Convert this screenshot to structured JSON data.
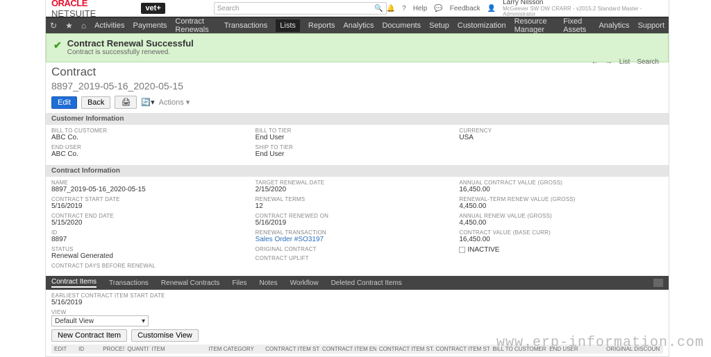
{
  "brand": {
    "oracle": "ORACLE",
    "suite": " NETSUITE",
    "vet": "vet+"
  },
  "search": {
    "placeholder": "Search"
  },
  "topright": {
    "help": "Help",
    "feedback": "Feedback"
  },
  "user": {
    "name": "Larry Nilsson",
    "role": "McGeever SW OW CRARR - v2015.2 Standard Master - Administrator"
  },
  "menu": {
    "items": [
      "Activities",
      "Payments",
      "Contract Renewals",
      "Transactions",
      "Lists",
      "Reports",
      "Analytics",
      "Documents",
      "Setup",
      "Customization",
      "Resource Manager",
      "Fixed Assets",
      "Analytics",
      "Support"
    ],
    "active_index": 4
  },
  "banner": {
    "title": "Contract Renewal Successful",
    "sub": "Contract is successfully renewed."
  },
  "record": {
    "type": "Contract",
    "name": "8897_2019-05-16_2020-05-15"
  },
  "buttons": {
    "edit": "Edit",
    "back": "Back",
    "actions": "Actions"
  },
  "pagenav": {
    "list": "List",
    "search": "Search"
  },
  "sections": {
    "customer": {
      "title": "Customer Information",
      "c1": [
        {
          "label": "BILL TO CUSTOMER",
          "value": "ABC Co."
        },
        {
          "label": "END USER",
          "value": "ABC Co."
        }
      ],
      "c2": [
        {
          "label": "BILL TO TIER",
          "value": "End User"
        },
        {
          "label": "SHIP TO TIER",
          "value": "End User"
        }
      ],
      "c3": [
        {
          "label": "CURRENCY",
          "value": "USA"
        }
      ]
    },
    "contract": {
      "title": "Contract Information",
      "c1": [
        {
          "label": "NAME",
          "value": "8897_2019-05-16_2020-05-15"
        },
        {
          "label": "CONTRACT START DATE",
          "value": "5/16/2019"
        },
        {
          "label": "CONTRACT END DATE",
          "value": "5/15/2020"
        },
        {
          "label": "ID",
          "value": "8897"
        },
        {
          "label": "STATUS",
          "value": "Renewal Generated"
        },
        {
          "label": "CONTRACT DAYS BEFORE RENEWAL",
          "value": ""
        }
      ],
      "c2": [
        {
          "label": "TARGET RENEWAL DATE",
          "value": "2/15/2020"
        },
        {
          "label": "RENEWAL TERMS",
          "value": "12"
        },
        {
          "label": "CONTRACT RENEWED ON",
          "value": "5/16/2019"
        },
        {
          "label": "RENEWAL TRANSACTION",
          "value": "Sales Order #SO3197",
          "link": true
        },
        {
          "label": "ORIGINAL CONTRACT",
          "value": ""
        },
        {
          "label": "CONTRACT UPLIFT",
          "value": ""
        }
      ],
      "c3": [
        {
          "label": "ANNUAL CONTRACT VALUE (GROSS)",
          "value": "16,450.00"
        },
        {
          "label": "RENEWAL-TERM RENEW VALUE (GROSS)",
          "value": "4,450.00"
        },
        {
          "label": "ANNUAL RENEW VALUE (GROSS)",
          "value": "4,450.00"
        },
        {
          "label": "CONTRACT VALUE (BASE CURR)",
          "value": "16,450.00"
        },
        {
          "label": "INACTIVE",
          "value": "",
          "checkbox": true
        }
      ]
    }
  },
  "subtabs": [
    "Contract Items",
    "Transactions",
    "Renewal Contracts",
    "Files",
    "Notes",
    "Workflow",
    "Deleted Contract Items"
  ],
  "sublist": {
    "earliest_label": "EARLIEST CONTRACT ITEM START DATE",
    "earliest_value": "5/16/2019",
    "view_label": "VIEW",
    "view_value": "Default View",
    "new_item": "New Contract Item",
    "customise": "Customise View",
    "cols": [
      "EDIT",
      "ID",
      "PROCESS",
      "QUANTITY",
      "ITEM",
      "ITEM CATEGORY",
      "CONTRACT ITEM START DATE",
      "CONTRACT ITEM END DATE",
      "CONTRACT ITEM STATUS",
      "CONTRACT ITEM STATE",
      "BILL TO CUSTOMER",
      "END USER",
      "ORIGINAL DISCOUNT"
    ]
  },
  "watermark": "www.erp-information.com"
}
